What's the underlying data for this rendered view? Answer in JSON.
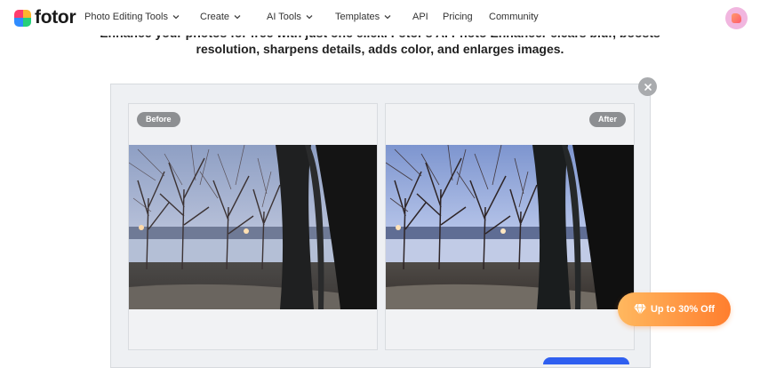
{
  "brand": {
    "name": "fotor"
  },
  "nav": [
    {
      "label": "Photo Editing Tools",
      "has_dropdown": true
    },
    {
      "label": "Create",
      "has_dropdown": true
    },
    {
      "label": "AI Tools",
      "has_dropdown": true
    },
    {
      "label": "Templates",
      "has_dropdown": true
    },
    {
      "label": "API",
      "has_dropdown": false
    },
    {
      "label": "Pricing",
      "has_dropdown": false
    },
    {
      "label": "Community",
      "has_dropdown": false
    }
  ],
  "hero": {
    "line1": "Enhance your photos for free with just one click. Fotor's AI Photo Enhancer clears blur, boosts",
    "line2": "resolution, sharpens details, adds color, and enlarges images."
  },
  "compare": {
    "before_label": "Before",
    "after_label": "After"
  },
  "promo": {
    "label": "Up to 30% Off"
  },
  "colors": {
    "accent_orange": "#ff8a3a",
    "button_blue": "#2f5ff0",
    "pill_gray": "#8d8f92"
  },
  "icons": {
    "close": "close-icon",
    "chevron": "chevron-down-icon",
    "gem": "diamond-icon"
  }
}
